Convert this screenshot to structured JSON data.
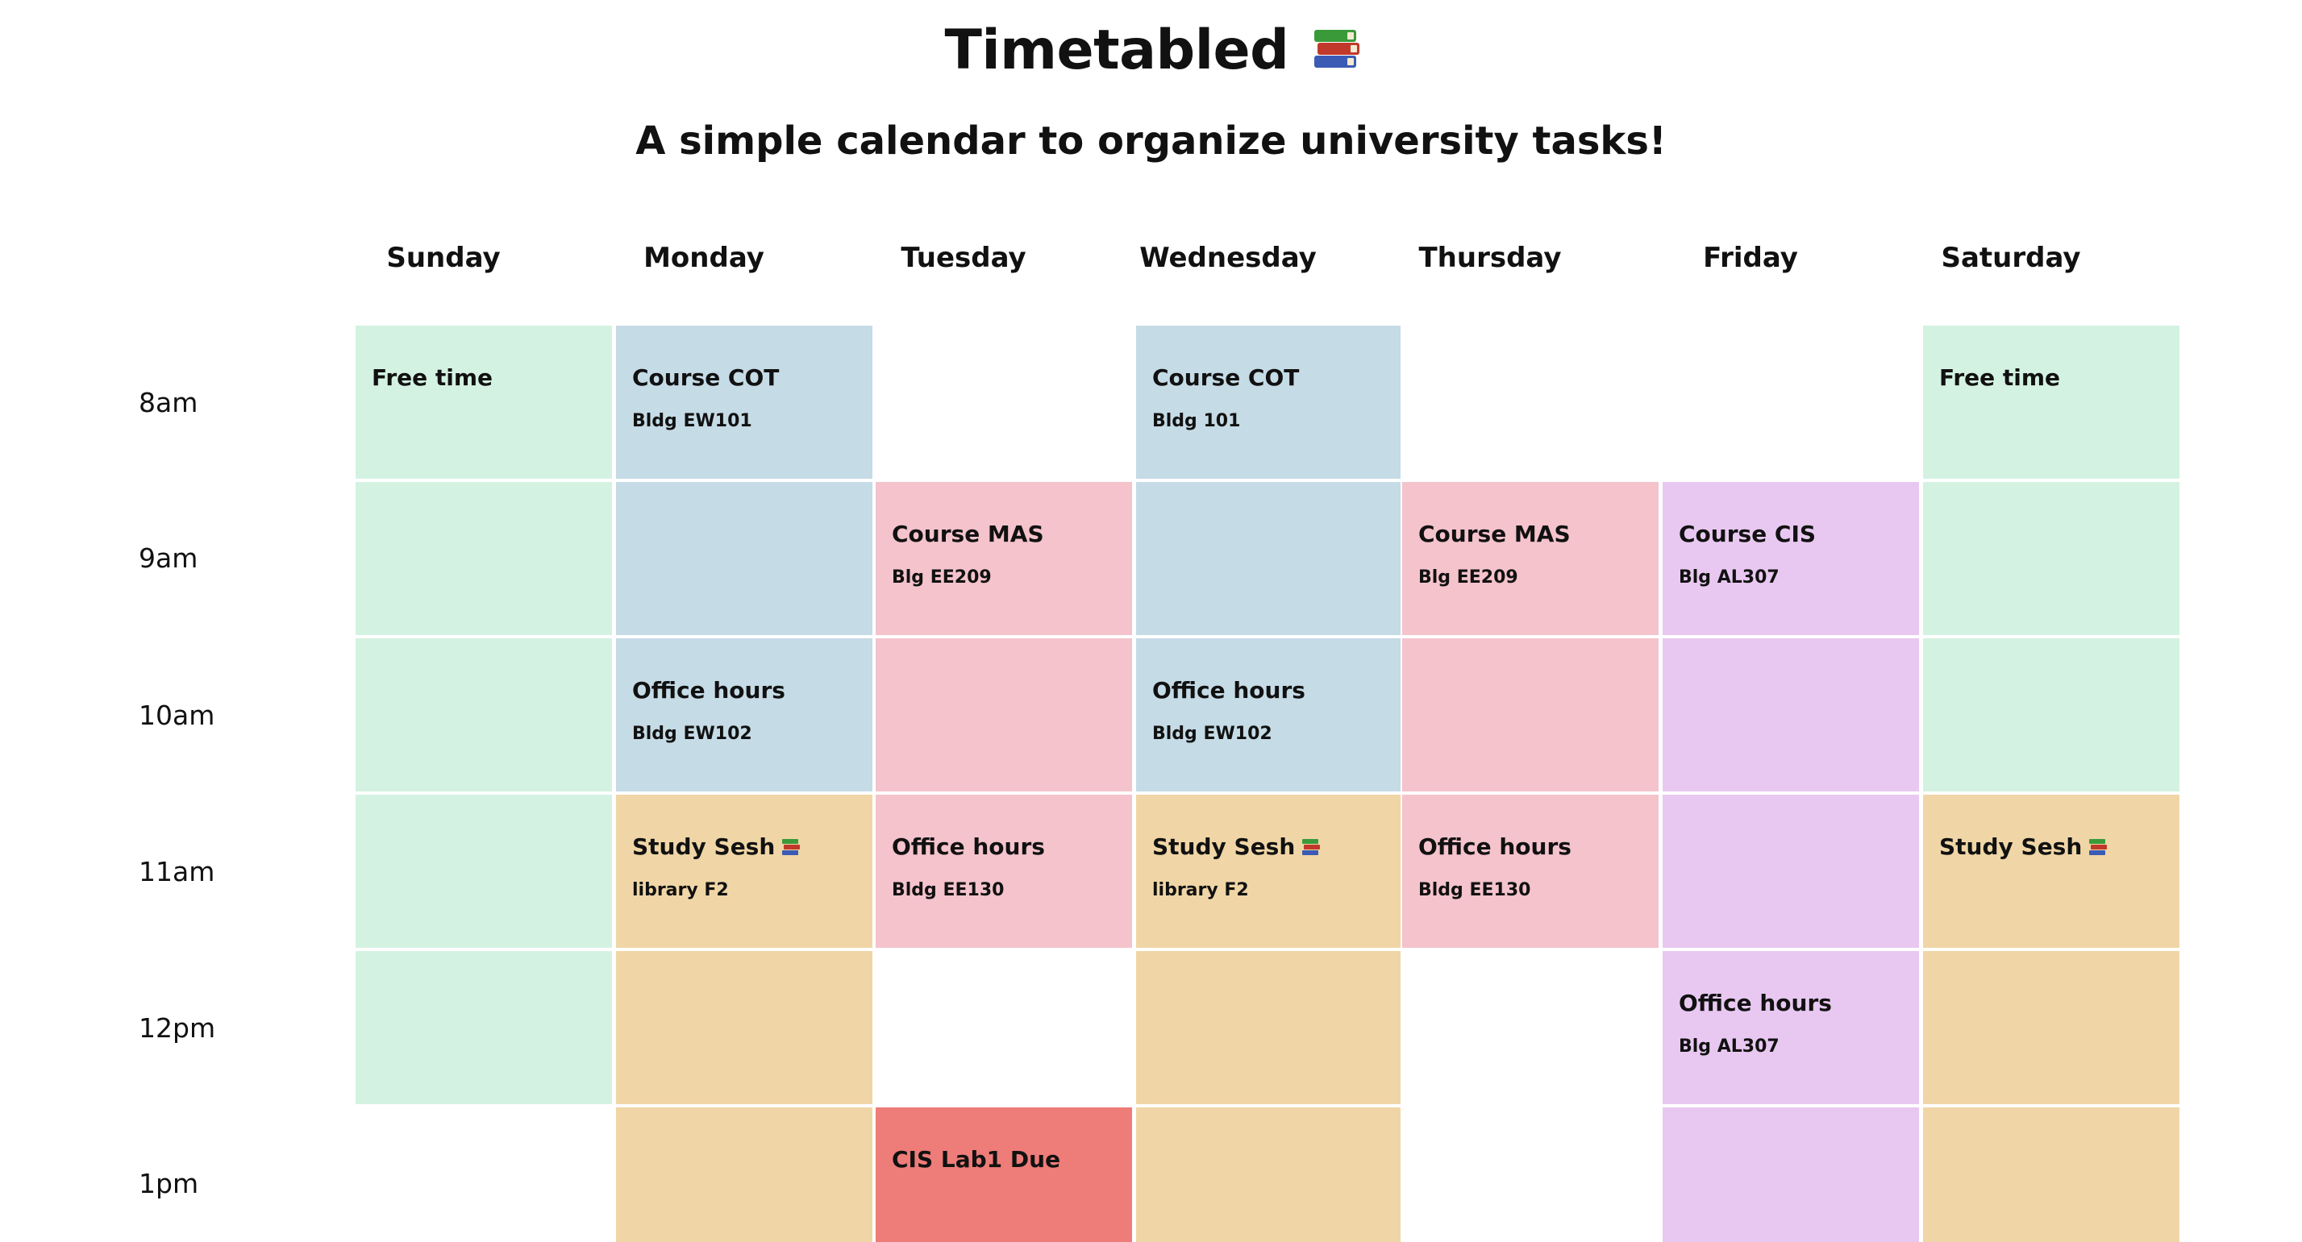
{
  "header": {
    "title": "Timetabled",
    "title_icon": "books-icon",
    "subtitle": "A simple calendar to organize university tasks!"
  },
  "days": [
    "Sunday",
    "Monday",
    "Tuesday",
    "Wednesday",
    "Thursday",
    "Friday",
    "Saturday"
  ],
  "times": [
    "8am",
    "9am",
    "10am",
    "11am",
    "12pm",
    "1pm"
  ],
  "colors": {
    "free": "#d4f2e2",
    "cot": "#c5dbe6",
    "mas": "#f4c3cc",
    "cis": "#e8c8f1",
    "study": "#f0d6a6",
    "due": "#ee7c78"
  },
  "events": [
    {
      "title": "Free time",
      "location": "",
      "color": "free",
      "day": 0,
      "start": 0,
      "span": 5
    },
    {
      "title": "Course COT",
      "location": "Bldg EW101",
      "color": "cot",
      "day": 1,
      "start": 0,
      "span": 2
    },
    {
      "title": "Office hours",
      "location": "Bldg EW102",
      "color": "cot",
      "day": 1,
      "start": 2,
      "span": 1
    },
    {
      "title": "Study Sesh",
      "location": "library F2",
      "color": "study",
      "day": 1,
      "start": 3,
      "span": 3,
      "icon": true
    },
    {
      "title": "Course MAS",
      "location": "Blg EE209",
      "color": "mas",
      "day": 2,
      "start": 1,
      "span": 2
    },
    {
      "title": "Office hours",
      "location": "Bldg EE130",
      "color": "mas",
      "day": 2,
      "start": 3,
      "span": 1
    },
    {
      "title": "CIS Lab1 Due",
      "location": "",
      "color": "due",
      "day": 2,
      "start": 5,
      "span": 1
    },
    {
      "title": "Course COT",
      "location": "Bldg 101",
      "color": "cot",
      "day": 3,
      "start": 0,
      "span": 2
    },
    {
      "title": "Office hours",
      "location": "Bldg EW102",
      "color": "cot",
      "day": 3,
      "start": 2,
      "span": 1
    },
    {
      "title": "Study Sesh",
      "location": "library F2",
      "color": "study",
      "day": 3,
      "start": 3,
      "span": 3,
      "icon": true
    },
    {
      "title": "Course MAS",
      "location": "Blg EE209",
      "color": "mas",
      "day": 4,
      "start": 1,
      "span": 2
    },
    {
      "title": "Office hours",
      "location": "Bldg EE130",
      "color": "mas",
      "day": 4,
      "start": 3,
      "span": 1
    },
    {
      "title": "Course CIS",
      "location": "Blg AL307",
      "color": "cis",
      "day": 5,
      "start": 1,
      "span": 3
    },
    {
      "title": "Office hours",
      "location": "Blg AL307",
      "color": "cis",
      "day": 5,
      "start": 4,
      "span": 2
    },
    {
      "title": "Free time",
      "location": "",
      "color": "free",
      "day": 6,
      "start": 0,
      "span": 3
    },
    {
      "title": "Study Sesh",
      "location": "",
      "color": "study",
      "day": 6,
      "start": 3,
      "span": 3,
      "icon": true
    }
  ]
}
